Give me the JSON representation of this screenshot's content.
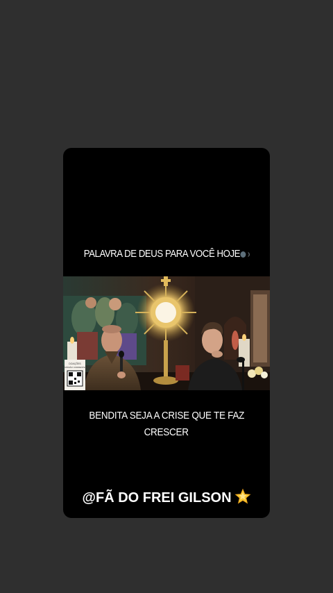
{
  "story": {
    "top_caption": "PALAVRA DE DEUS PARA VOCÊ HOJE",
    "top_caption_emoji": "speaking-head-icon",
    "bottom_caption_line1": "BENDITA SEJA A CRISE QUE TE FAZ",
    "bottom_caption_line2": "CRESCER",
    "handle_text": "@FÃ DO FREI GILSON",
    "handle_emoji": "glowing-star-icon"
  },
  "video": {
    "qr_label_1": "DOAÇÕES",
    "qr_label_2": "MISSÃO CORRENTE"
  },
  "colors": {
    "page_background": "#2f2f2f",
    "card_background": "#000000",
    "text": "#ffffff",
    "star": "#f6c531"
  }
}
